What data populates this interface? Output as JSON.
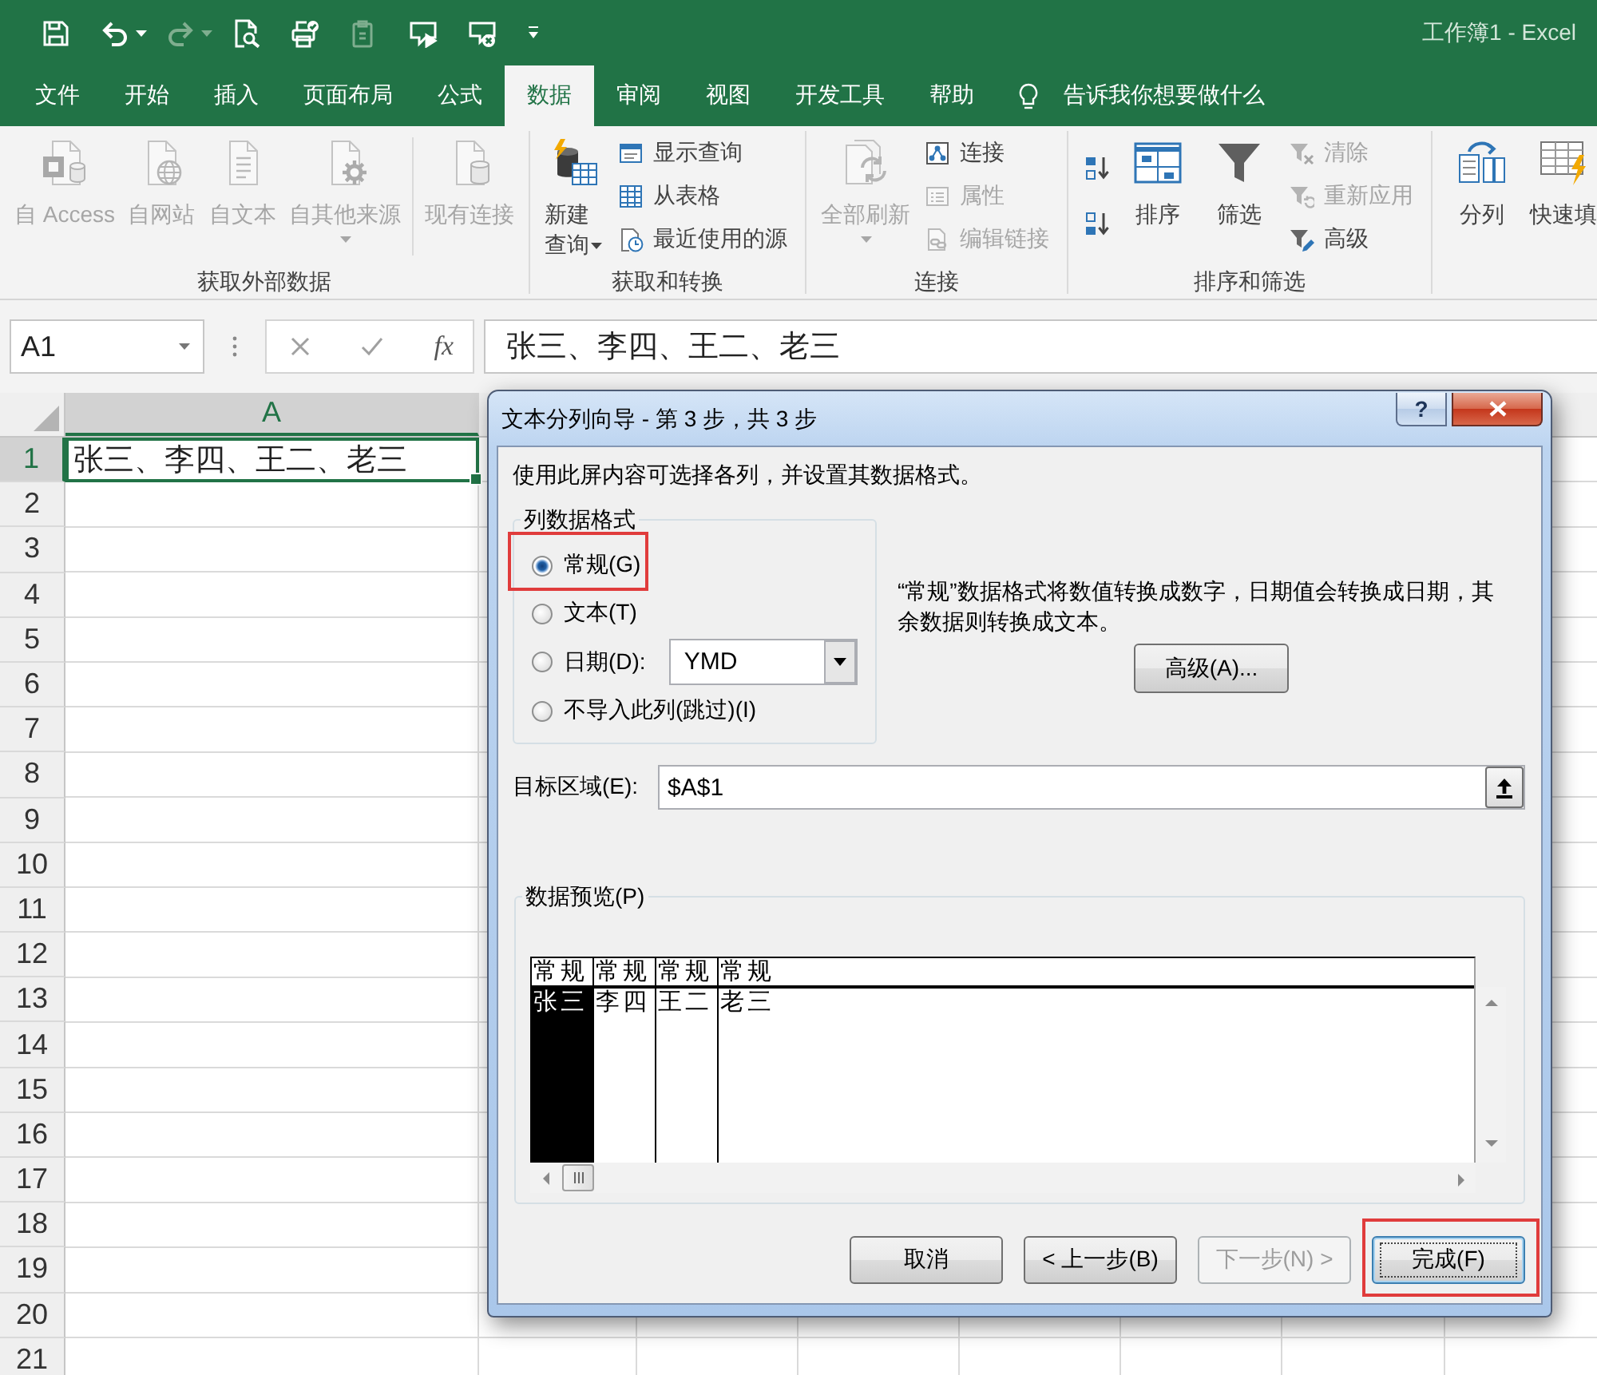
{
  "window": {
    "title": "工作簿1 - Excel"
  },
  "quick_access": [
    {
      "disabled": false
    },
    {
      "disabled": false,
      "dropdown": true
    },
    {
      "disabled": true,
      "dropdown": true
    },
    {
      "disabled": false
    },
    {
      "disabled": false
    },
    {
      "disabled": true
    },
    {
      "disabled": false
    },
    {
      "disabled": false
    }
  ],
  "tabs": [
    {
      "label": "文件",
      "selected": false
    },
    {
      "label": "开始",
      "selected": false
    },
    {
      "label": "插入",
      "selected": false
    },
    {
      "label": "页面布局",
      "selected": false
    },
    {
      "label": "公式",
      "selected": false
    },
    {
      "label": "数据",
      "selected": true
    },
    {
      "label": "审阅",
      "selected": false
    },
    {
      "label": "视图",
      "selected": false
    },
    {
      "label": "开发工具",
      "selected": false
    },
    {
      "label": "帮助",
      "selected": false
    }
  ],
  "tell_me": {
    "label": "告诉我你想要做什么"
  },
  "ribbon": {
    "groups": [
      {
        "label": "获取外部数据",
        "controls": [
          {
            "kind": "large",
            "label": "自 Access",
            "disabled": true
          },
          {
            "kind": "large",
            "label": "自网站",
            "disabled": true
          },
          {
            "kind": "large",
            "label": "自文本",
            "disabled": true
          },
          {
            "kind": "large",
            "label": "自其他来源",
            "disabled": true,
            "dropdown": true
          },
          {
            "kind": "separator"
          },
          {
            "kind": "large",
            "label": "现有连接",
            "disabled": true
          }
        ]
      },
      {
        "label": "获取和转换",
        "controls": [
          {
            "kind": "twoline",
            "label": "新建查询",
            "disabled": false,
            "dropdown": true
          },
          {
            "kind": "stack",
            "items": [
              {
                "label": "显示查询",
                "disabled": false
              },
              {
                "label": "从表格",
                "disabled": false
              },
              {
                "label": "最近使用的源",
                "disabled": false
              }
            ]
          }
        ]
      },
      {
        "label": "连接",
        "controls": [
          {
            "kind": "large",
            "label": "全部刷新",
            "disabled": true,
            "dropdown": true
          },
          {
            "kind": "stack",
            "items": [
              {
                "label": "连接",
                "disabled": false
              },
              {
                "label": "属性",
                "disabled": true
              },
              {
                "label": "编辑链接",
                "disabled": true
              }
            ]
          }
        ]
      },
      {
        "label": "排序和筛选",
        "controls": [
          {
            "kind": "iconstack",
            "items": [
              {
                "disabled": false
              },
              {
                "disabled": false
              }
            ]
          },
          {
            "kind": "large",
            "label": "排序",
            "disabled": false
          },
          {
            "kind": "large",
            "label": "筛选",
            "disabled": false
          },
          {
            "kind": "stack",
            "items": [
              {
                "label": "清除",
                "disabled": true
              },
              {
                "label": "重新应用",
                "disabled": true
              },
              {
                "label": "高级",
                "disabled": false
              }
            ]
          }
        ]
      },
      {
        "controls": [
          {
            "kind": "large",
            "label": "分列",
            "disabled": false
          },
          {
            "kind": "large",
            "label": "快速填",
            "disabled": false
          }
        ]
      }
    ]
  },
  "formula_bar": {
    "name_box": "A1",
    "function_button": "fx",
    "formula": "张三、李四、王二、老三"
  },
  "sheet": {
    "columns": [
      {
        "label": "A",
        "selected": true
      }
    ],
    "rows": [
      {
        "label": "1",
        "selected": true,
        "cells": [
          {
            "text": "张三、李四、王二、老三",
            "active": true
          }
        ]
      },
      {
        "label": "2",
        "selected": false
      },
      {
        "label": "3",
        "selected": false
      },
      {
        "label": "4",
        "selected": false
      },
      {
        "label": "5",
        "selected": false
      },
      {
        "label": "6",
        "selected": false
      },
      {
        "label": "7",
        "selected": false
      },
      {
        "label": "8",
        "selected": false
      },
      {
        "label": "9",
        "selected": false
      },
      {
        "label": "10",
        "selected": false
      },
      {
        "label": "11",
        "selected": false
      },
      {
        "label": "12",
        "selected": false
      },
      {
        "label": "13",
        "selected": false
      },
      {
        "label": "14",
        "selected": false
      },
      {
        "label": "15",
        "selected": false
      },
      {
        "label": "16",
        "selected": false
      },
      {
        "label": "17",
        "selected": false
      },
      {
        "label": "18",
        "selected": false
      },
      {
        "label": "19",
        "selected": false
      },
      {
        "label": "20",
        "selected": false
      },
      {
        "label": "21",
        "selected": false
      }
    ]
  },
  "dialog": {
    "title": "文本分列向导 - 第 3 步，共 3 步",
    "help_button": "?",
    "instruction": "使用此屏内容可选择各列，并设置其数据格式。",
    "format_group": {
      "label": "列数据格式",
      "options": [
        {
          "label": "常规(G)",
          "selected": true,
          "highlighted": true
        },
        {
          "label": "文本(T)",
          "selected": false,
          "highlighted": false
        },
        {
          "label": "日期(D):",
          "selected": false,
          "highlighted": false,
          "dropdown": "YMD"
        },
        {
          "label": "不导入此列(跳过)(I)",
          "selected": false,
          "highlighted": false
        }
      ]
    },
    "description": "“常规”数据格式将数值转换成数字，日期值会转换成日期，其余数据则转换成文本。",
    "advanced_button": "高级(A)...",
    "destination": {
      "label": "目标区域(E):",
      "value": "$A$1"
    },
    "preview": {
      "label": "数据预览(P)",
      "columns": [
        {
          "header": "常规",
          "value": "张三",
          "selected": true
        },
        {
          "header": "常规",
          "value": "李四",
          "selected": false
        },
        {
          "header": "常规",
          "value": "王二",
          "selected": false
        },
        {
          "header": "常规",
          "value": "老三",
          "selected": false
        }
      ]
    },
    "buttons": [
      {
        "label": "取消",
        "disabled": false,
        "focused": false,
        "highlighted": false
      },
      {
        "label": "< 上一步(B)",
        "disabled": false,
        "focused": false,
        "highlighted": false
      },
      {
        "label": "下一步(N) >",
        "disabled": true,
        "focused": false,
        "highlighted": false
      },
      {
        "label": "完成(F)",
        "disabled": false,
        "focused": true,
        "highlighted": true
      }
    ]
  }
}
